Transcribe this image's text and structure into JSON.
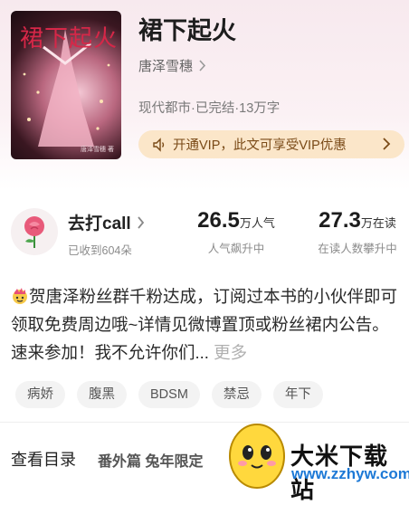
{
  "book": {
    "cover_title": "裙下起火",
    "cover_author": "唐泽雪穗 著",
    "title": "裙下起火",
    "author": "唐泽雪穗",
    "meta": "现代都市·已完结·13万字"
  },
  "vip": {
    "text": "开通VIP，此文可享受VIP优惠"
  },
  "call": {
    "label": "去打call",
    "sub": "已收到604朵"
  },
  "stats": [
    {
      "num": "26.5",
      "unit": "万人气",
      "sub": "人气飙升中"
    },
    {
      "num": "27.3",
      "unit": "万在读",
      "sub": "在读人数攀升中"
    }
  ],
  "description": {
    "text": "贺唐泽粉丝群千粉达成，订阅过本书的小伙伴即可领取免费周边哦~详情见微博置顶或粉丝裙内公告。速来参加！我不允许你们...",
    "more": "更多"
  },
  "tags": [
    "病娇",
    "腹黑",
    "BDSM",
    "禁忌",
    "年下"
  ],
  "catalog": {
    "label": "查看目录",
    "latest": "番外篇 兔年限定"
  },
  "watermark": {
    "name": "大米下载站",
    "url": "www.zzhyw.com"
  },
  "colors": {
    "vip_bg": "#fbe6c9",
    "vip_text": "#7a4a17",
    "url_blue": "#1d79d6"
  }
}
